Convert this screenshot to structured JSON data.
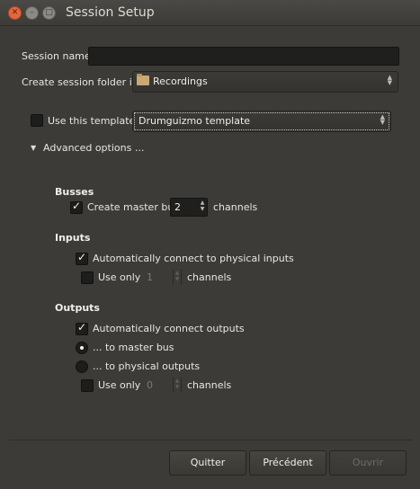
{
  "window": {
    "title": "Session Setup"
  },
  "session": {
    "name_label": "Session name:",
    "name_value": "",
    "folder_label": "Create session folder in:",
    "folder_value": "Recordings"
  },
  "template": {
    "checkbox_label": "Use this template",
    "checked": false,
    "selected": "Drumguizmo template"
  },
  "advanced": {
    "label": "Advanced options ...",
    "expanded": true
  },
  "busses": {
    "title": "Busses",
    "create_master_label": "Create master bus",
    "create_master_checked": true,
    "channels_value": "2",
    "channels_label": "channels"
  },
  "inputs": {
    "title": "Inputs",
    "auto_connect_label": "Automatically connect to physical inputs",
    "auto_connect_checked": true,
    "use_only_label": "Use only",
    "use_only_checked": false,
    "use_only_value": "1",
    "channels_label": "channels"
  },
  "outputs": {
    "title": "Outputs",
    "auto_connect_label": "Automatically connect outputs",
    "auto_connect_checked": true,
    "to_master_label": "... to master bus",
    "to_master_selected": true,
    "to_physical_label": "... to physical outputs",
    "to_physical_selected": false,
    "use_only_label": "Use only",
    "use_only_checked": false,
    "use_only_value": "0",
    "channels_label": "channels"
  },
  "buttons": {
    "quit": "Quitter",
    "previous": "Précédent",
    "open": "Ouvrir"
  }
}
